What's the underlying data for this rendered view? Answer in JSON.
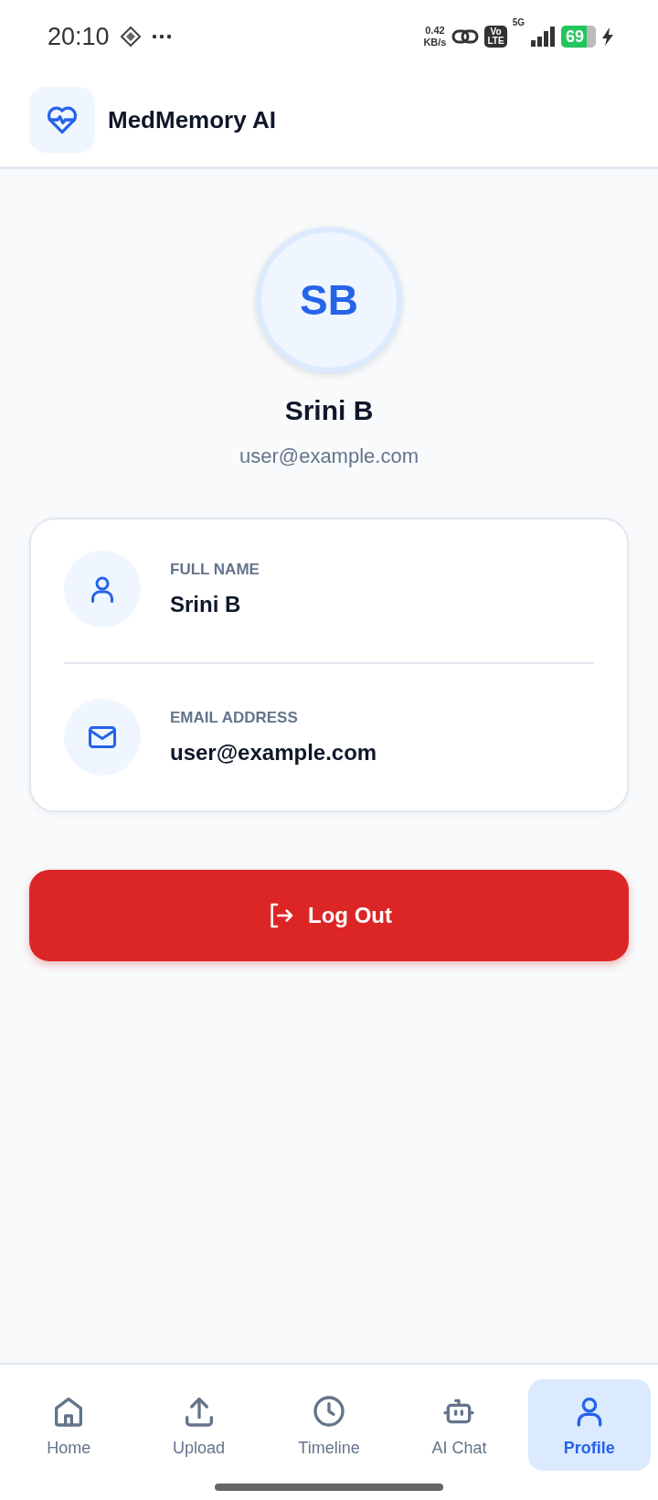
{
  "status_bar": {
    "time": "20:10",
    "speed_value": "0.42",
    "speed_unit": "KB/s",
    "volte_top": "Vo",
    "volte_bottom": "LTE",
    "network": "5G",
    "battery": "69"
  },
  "header": {
    "title": "MedMemory AI"
  },
  "profile": {
    "initials": "SB",
    "name": "Srini B",
    "email": "user@example.com"
  },
  "details": [
    {
      "kind": "person",
      "label": "FULL NAME",
      "value": "Srini B"
    },
    {
      "kind": "email",
      "label": "EMAIL ADDRESS",
      "value": "user@example.com"
    }
  ],
  "logout_button": {
    "label": "Log Out"
  },
  "bottom_nav": [
    {
      "kind": "home",
      "label": "Home",
      "selected": false
    },
    {
      "kind": "upload",
      "label": "Upload",
      "selected": false
    },
    {
      "kind": "clock",
      "label": "Timeline",
      "selected": false
    },
    {
      "kind": "robot",
      "label": "AI Chat",
      "selected": false
    },
    {
      "kind": "person",
      "label": "Profile",
      "selected": true
    }
  ]
}
